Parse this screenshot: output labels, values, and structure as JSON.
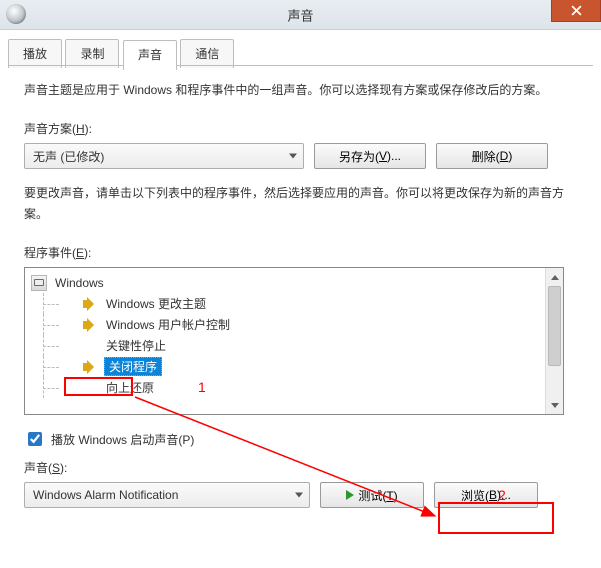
{
  "window": {
    "title": "声音"
  },
  "tabs": {
    "items": [
      {
        "label": "播放"
      },
      {
        "label": "录制"
      },
      {
        "label": "声音"
      },
      {
        "label": "通信"
      }
    ],
    "active_index": 2
  },
  "panel": {
    "description": "声音主题是应用于 Windows 和程序事件中的一组声音。你可以选择现有方案或保存修改后的方案。",
    "scheme_label_prefix": "声音方案(",
    "scheme_label_hotkey": "H",
    "scheme_label_suffix": "):",
    "scheme_value": "无声 (已修改)",
    "save_as_prefix": "另存为(",
    "save_as_hotkey": "V",
    "save_as_suffix": ")...",
    "delete_prefix": "删除(",
    "delete_hotkey": "D",
    "delete_suffix": ")",
    "events_desc": "要更改声音，请单击以下列表中的程序事件，然后选择要应用的声音。你可以将更改保存为新的声音方案。",
    "events_label_prefix": "程序事件(",
    "events_label_hotkey": "E",
    "events_label_suffix": "):",
    "tree": {
      "root": "Windows",
      "items": [
        {
          "label": "Windows 更改主题",
          "has_sound": true
        },
        {
          "label": "Windows 用户帐户控制",
          "has_sound": true
        },
        {
          "label": "关键性停止",
          "has_sound": false
        },
        {
          "label": "关闭程序",
          "has_sound": true,
          "selected": true
        },
        {
          "label": "向上还原",
          "has_sound": false
        }
      ]
    },
    "play_startup_prefix": "播放 Windows 启动声音(",
    "play_startup_hotkey": "P",
    "play_startup_suffix": ")",
    "play_startup_checked": true,
    "sound_label_prefix": "声音(",
    "sound_label_hotkey": "S",
    "sound_label_suffix": "):",
    "sound_value": "Windows Alarm Notification",
    "test_prefix": "测试(",
    "test_hotkey": "T",
    "test_suffix": ")",
    "browse_prefix": "浏览(",
    "browse_hotkey": "B",
    "browse_suffix": ")..."
  },
  "annotations": {
    "label1": "1",
    "label2": "2"
  }
}
